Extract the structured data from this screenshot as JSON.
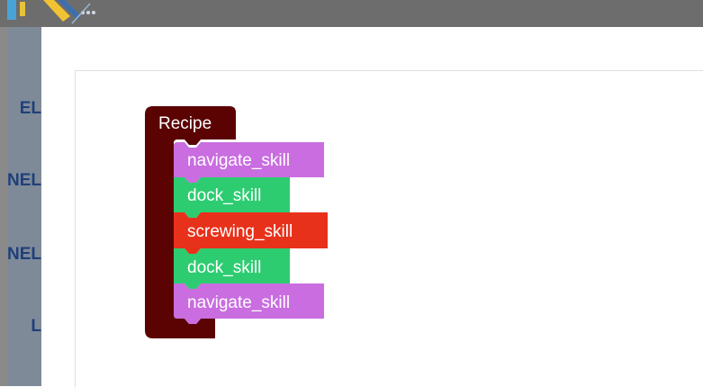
{
  "background_panel": {
    "labels": [
      "EL",
      "NEL",
      "NEL",
      "L"
    ]
  },
  "blocks": {
    "container": {
      "label": "Recipe",
      "color": "#5b0303"
    },
    "steps": [
      {
        "label": "navigate_skill",
        "color": "#c96de0"
      },
      {
        "label": "dock_skill",
        "color": "#2ecc71"
      },
      {
        "label": "screwing_skill",
        "color": "#e8311a"
      },
      {
        "label": "dock_skill",
        "color": "#2ecc71"
      },
      {
        "label": "navigate_skill",
        "color": "#c96de0"
      }
    ]
  },
  "colors": {
    "topbar": "#6d6d6d",
    "side_panel": "#7f8a99",
    "side_text": "#1f3f7a",
    "workspace_border": "#dedede"
  }
}
